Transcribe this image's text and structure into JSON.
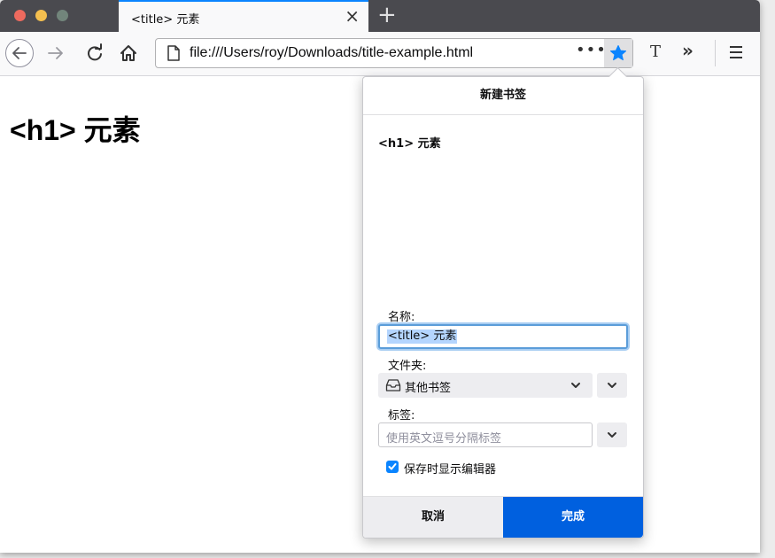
{
  "tab": {
    "title": "<title> 元素",
    "close_glyph": "×",
    "new_tab_glyph": "+"
  },
  "urlbar": {
    "url": "file:///Users/roy/Downloads/title-example.html",
    "more_glyph": "•••"
  },
  "toolbar": {
    "reader_glyph": "T",
    "overflow_glyph": "»"
  },
  "page": {
    "heading": "<h1> 元素"
  },
  "bookmark_panel": {
    "header": "新建书签",
    "preview_title": "<h1> 元素",
    "name_label": "名称:",
    "name_value": "<title> 元素",
    "folder_label": "文件夹:",
    "folder_value": "其他书签",
    "tags_label": "标签:",
    "tags_placeholder": "使用英文逗号分隔标签",
    "show_editor_label": "保存时显示编辑器",
    "show_editor_checked": true,
    "cancel_label": "取消",
    "done_label": "完成"
  },
  "icons": {
    "back": "back-arrow-icon",
    "forward": "forward-arrow-icon",
    "reload": "reload-icon",
    "home": "home-icon",
    "page": "page-icon",
    "star": "star-icon",
    "menu": "hamburger-menu-icon",
    "folder": "folder-tray-icon",
    "chevron": "chevron-down-icon",
    "check": "checkmark-icon"
  },
  "colors": {
    "accent": "#0a84ff",
    "primary_button": "#0060df",
    "tabstrip": "#4a4a4f"
  }
}
